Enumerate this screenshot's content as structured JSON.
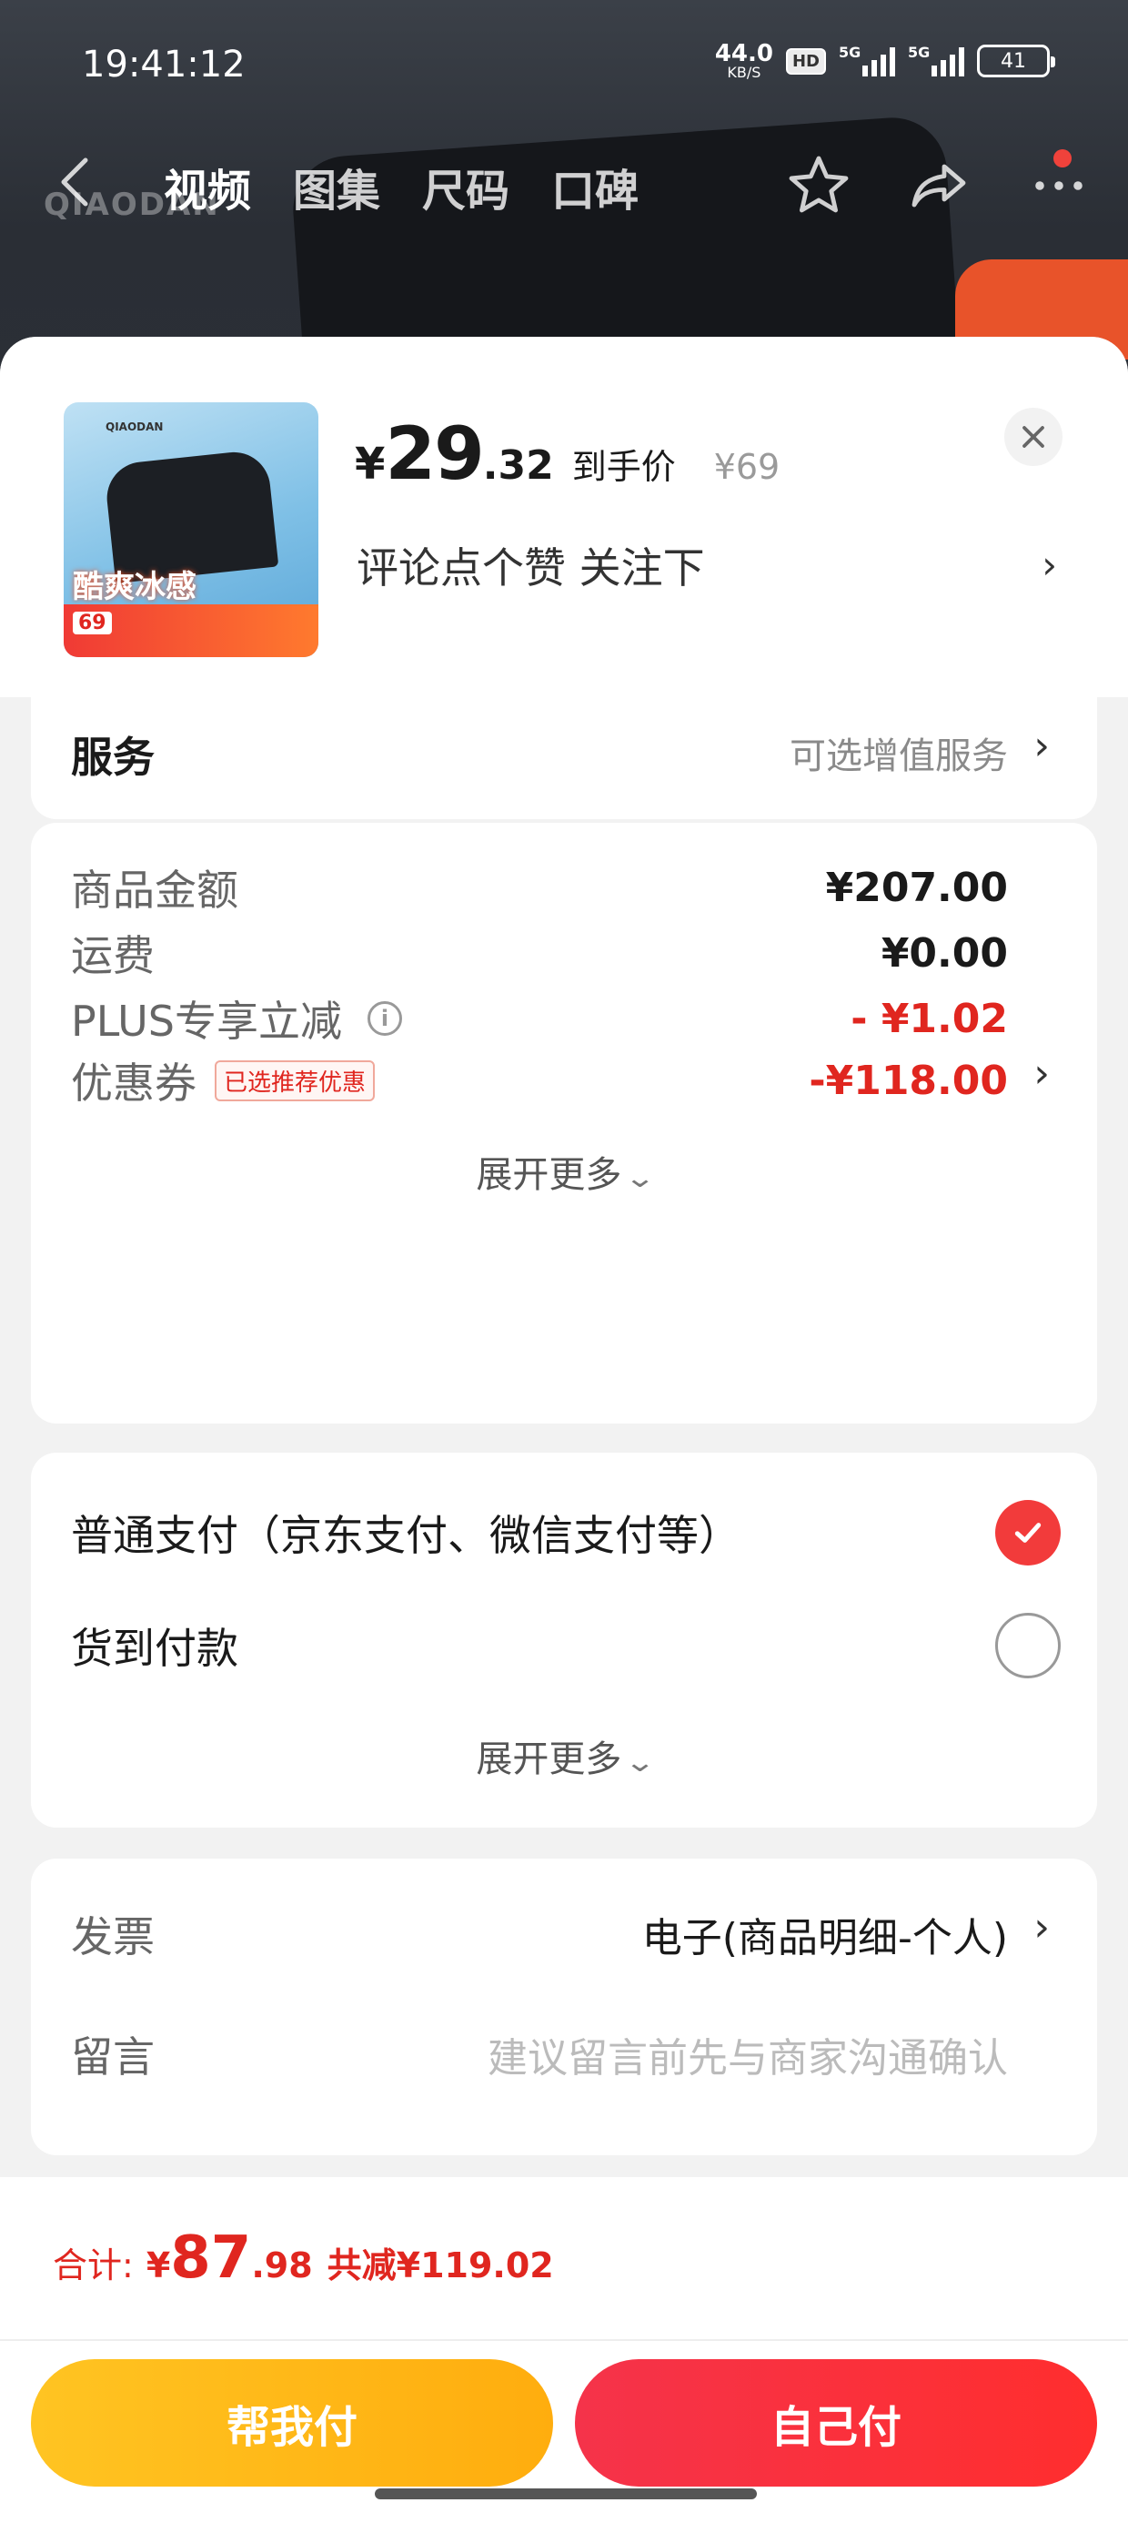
{
  "status_bar": {
    "time": "19:41:12",
    "net_speed": "44.0",
    "net_unit": "KB/S",
    "hd_label": "HD",
    "signal1_label": "5G",
    "signal2_label": "5G",
    "battery": "41"
  },
  "top_nav": {
    "tabs": [
      "视频",
      "图集",
      "尺码",
      "口碑"
    ],
    "active_tab": "视频"
  },
  "product": {
    "price_yen": "¥",
    "price_int": "29",
    "price_dec": ".32",
    "price_label": "到手价",
    "original_price": "¥69",
    "description": "评论点个赞 关注下",
    "thumb_price": "69"
  },
  "service": {
    "title": "服务",
    "value": "可选增值服务"
  },
  "amounts": {
    "rows": [
      {
        "label": "商品金额",
        "value": "¥207.00"
      },
      {
        "label": "运费",
        "value": "¥0.00"
      },
      {
        "label": "PLUS专享立减",
        "value": "- ¥1.02"
      },
      {
        "label": "优惠券",
        "value": "-¥118.00",
        "badge": "已选推荐优惠"
      }
    ],
    "expand_label": "展开更多"
  },
  "payment": {
    "options": [
      {
        "label": "普通支付（京东支付、微信支付等）",
        "selected": true
      },
      {
        "label": "货到付款",
        "selected": false
      }
    ],
    "expand_label": "展开更多"
  },
  "invoice": {
    "label": "发票",
    "value": "电子(商品明细-个人)",
    "message_label": "留言",
    "message_placeholder": "建议留言前先与商家沟通确认"
  },
  "summary": {
    "total_label": "合计:",
    "yen": "¥",
    "total_int": "87",
    "total_dec": ".98",
    "savings": "共减¥119.02"
  },
  "buttons": {
    "help_pay": "帮我付",
    "self_pay": "自己付"
  },
  "colors": {
    "accent_red": "#e0261f",
    "pay_button_red": "#f5334a",
    "help_button_yellow": "#ffc422"
  }
}
